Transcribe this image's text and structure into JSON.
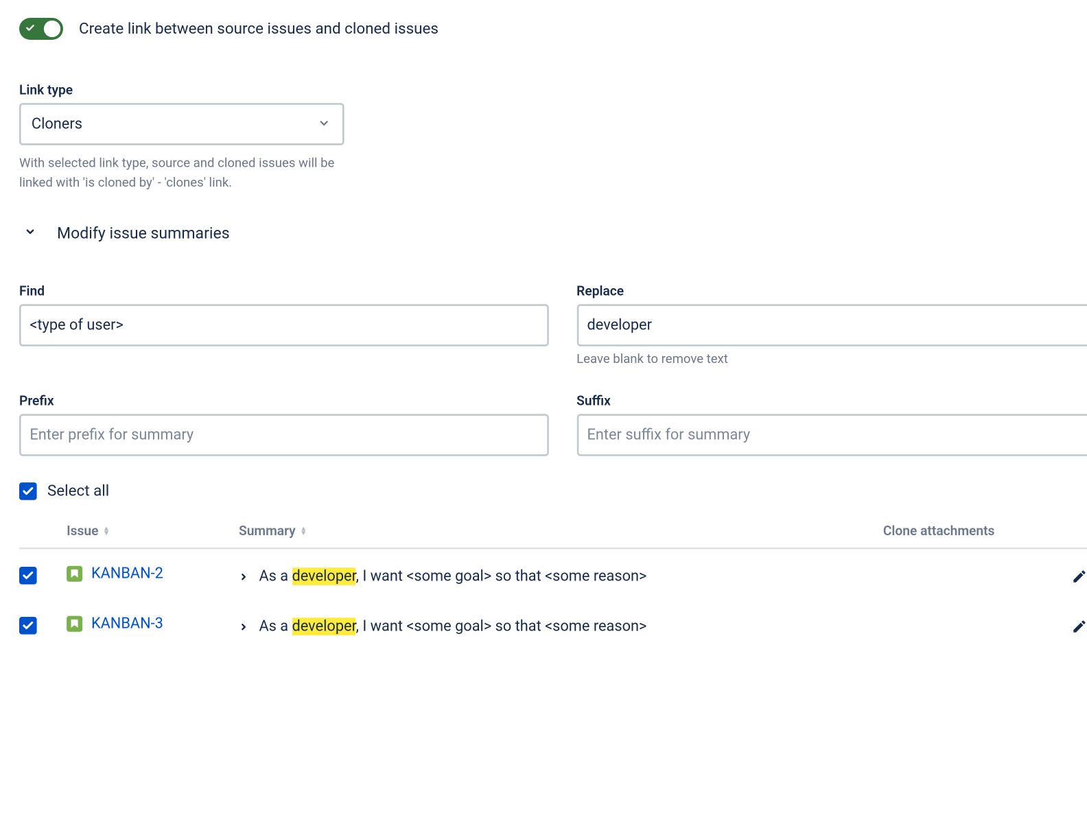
{
  "toggle": {
    "on": true,
    "label": "Create link between source issues and cloned issues"
  },
  "link_type": {
    "label": "Link type",
    "value": "Cloners",
    "help": "With selected link type, source and cloned issues will be linked with 'is cloned by' - 'clones' link."
  },
  "modify_section": {
    "title": "Modify issue summaries",
    "expanded": true
  },
  "find": {
    "label": "Find",
    "value": "<type of user>"
  },
  "replace": {
    "label": "Replace",
    "value": "developer",
    "help": "Leave blank to remove text"
  },
  "prefix": {
    "label": "Prefix",
    "placeholder": "Enter prefix for summary",
    "value": ""
  },
  "suffix": {
    "label": "Suffix",
    "placeholder": "Enter suffix for summary",
    "value": ""
  },
  "select_all": {
    "checked": true,
    "label": "Select all"
  },
  "table": {
    "headers": {
      "issue": "Issue",
      "summary": "Summary",
      "clone_attachments": "Clone attachments"
    },
    "rows": [
      {
        "checked": true,
        "key": "KANBAN-2",
        "summary_pre": "As a ",
        "summary_hl": "developer",
        "summary_post": ", I want <some goal> so that <some reason>"
      },
      {
        "checked": true,
        "key": "KANBAN-3",
        "summary_pre": "As a ",
        "summary_hl": "developer",
        "summary_post": ", I want <some goal> so that <some reason>"
      }
    ]
  }
}
